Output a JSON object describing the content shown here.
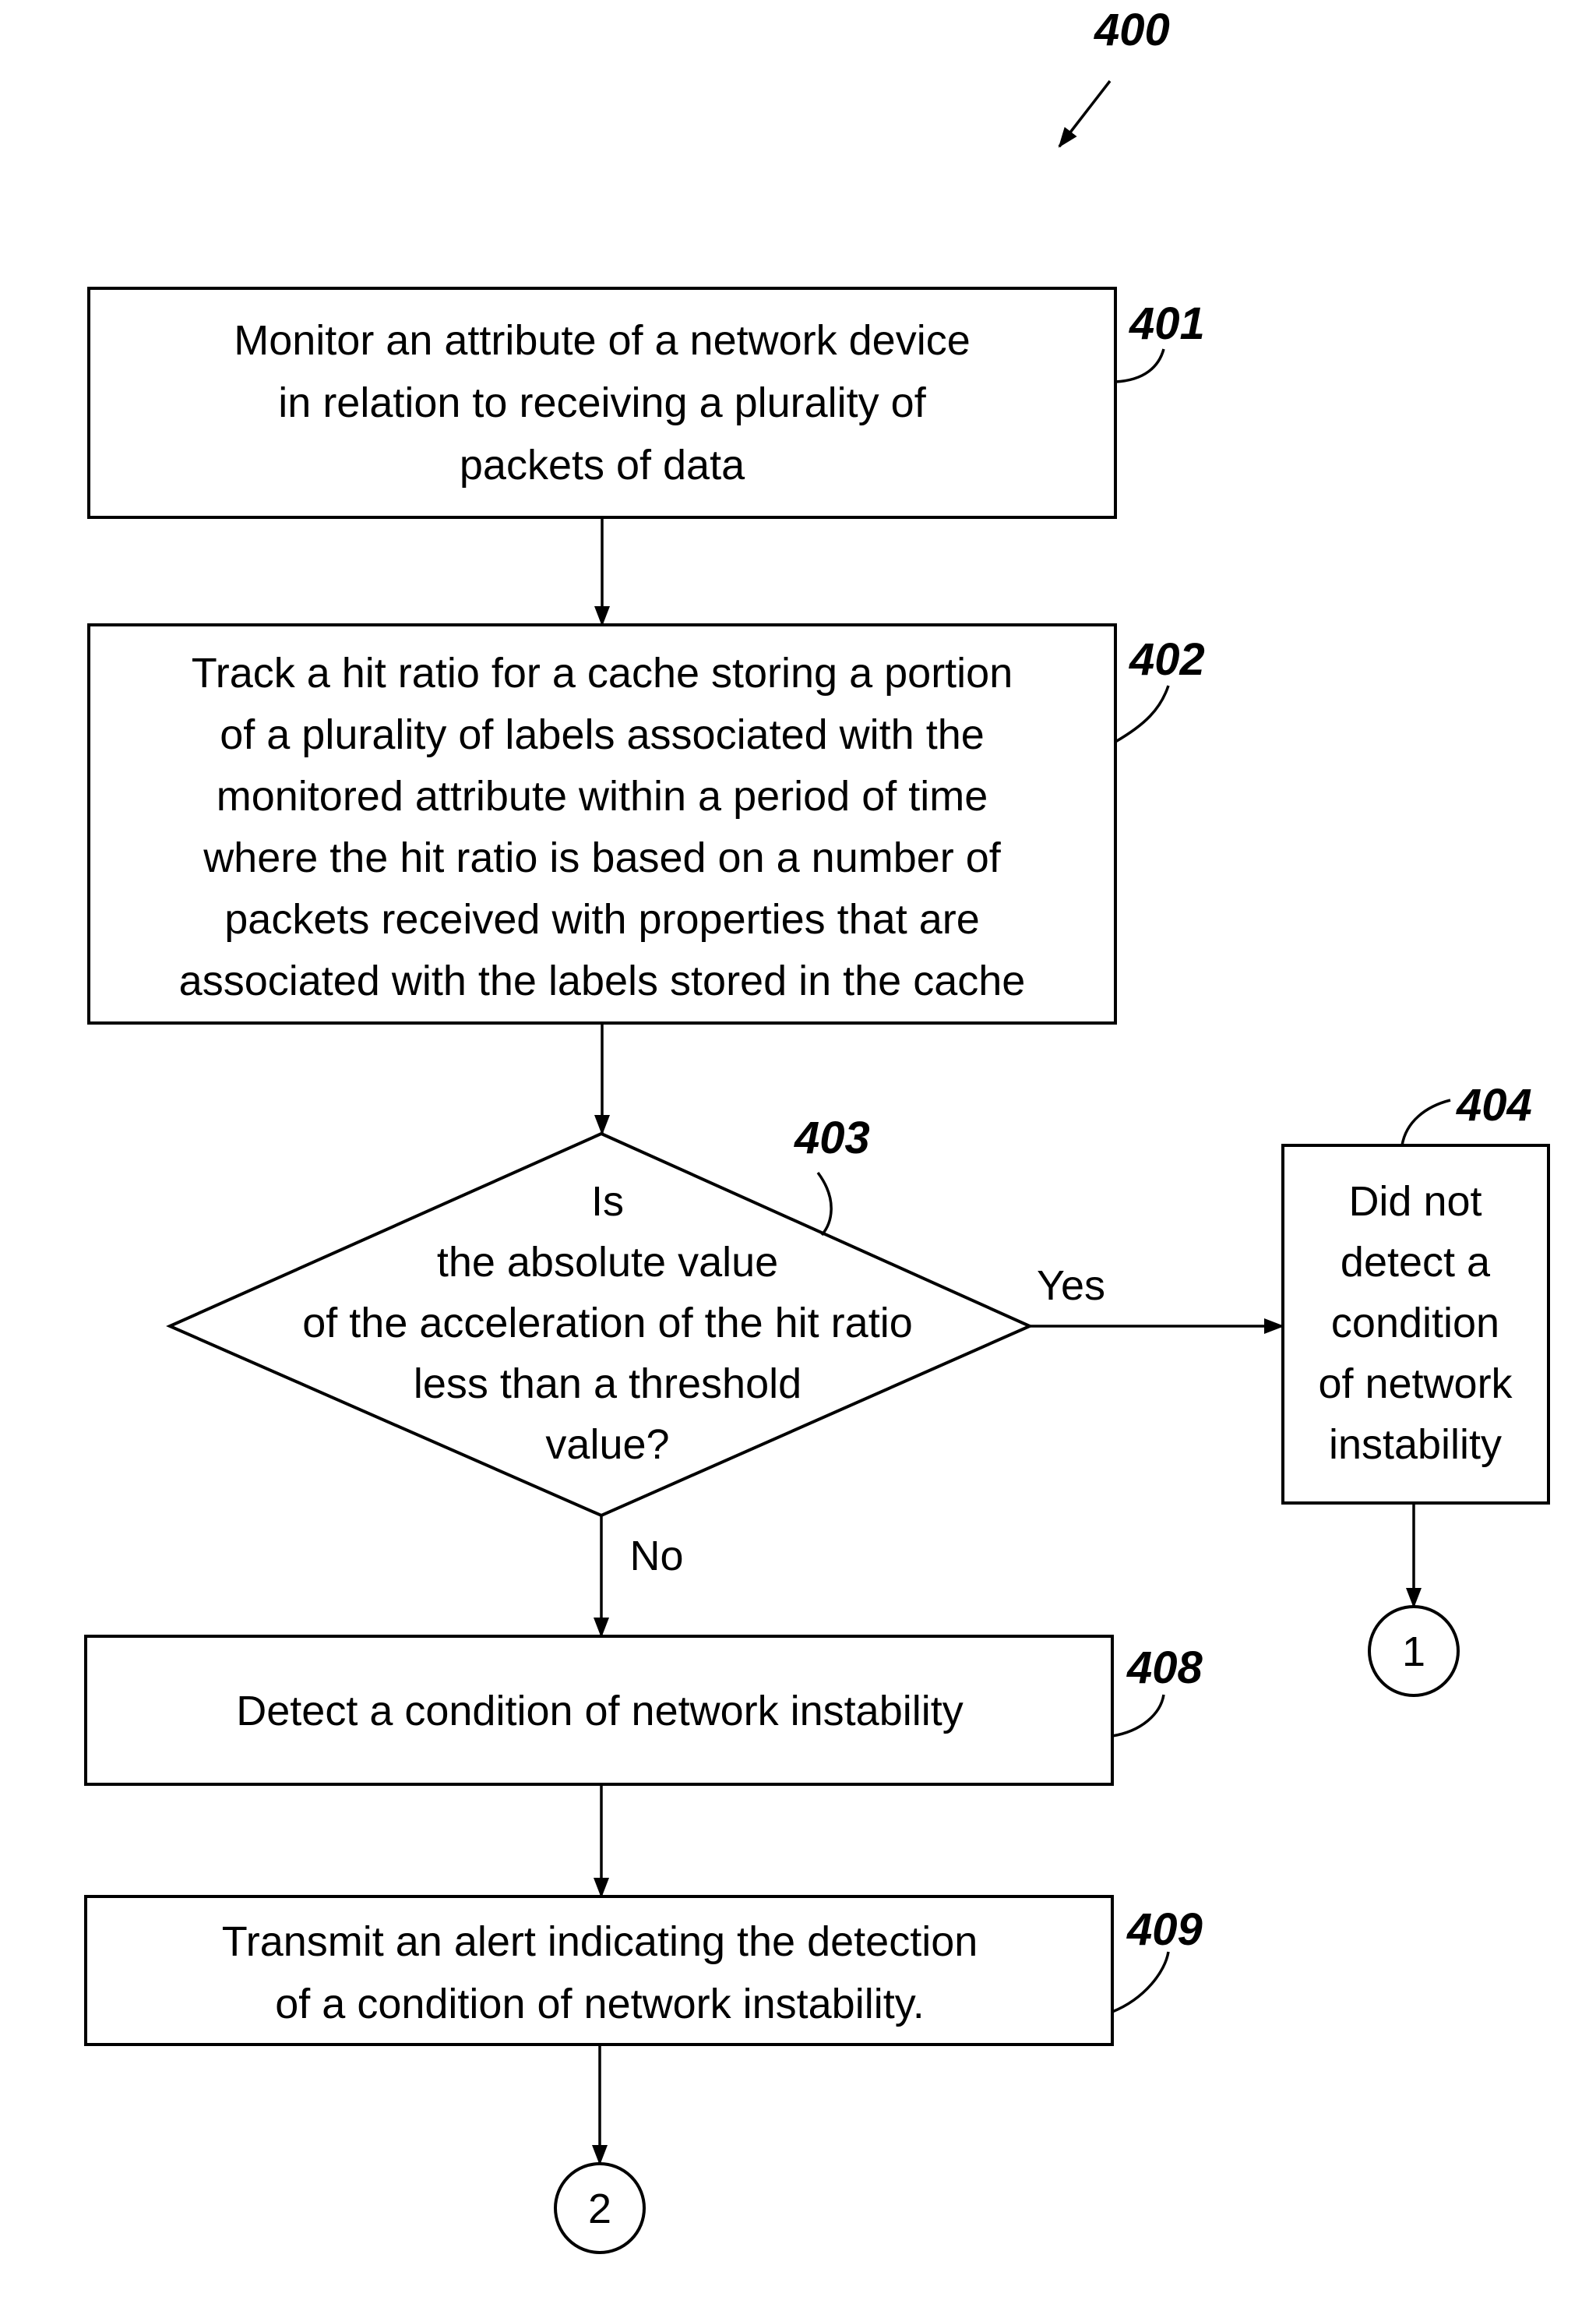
{
  "figure": {
    "ref": "400"
  },
  "steps": {
    "s401": {
      "ref": "401",
      "lines": [
        "Monitor an attribute of a network device",
        "in relation to receiving a plurality of",
        "packets of data"
      ]
    },
    "s402": {
      "ref": "402",
      "lines": [
        "Track a hit ratio for a cache storing a portion",
        "of a plurality of labels associated with the",
        "monitored attribute within a period of time",
        "where the hit ratio is based on a number of",
        "packets received with properties that are",
        "associated with the labels stored in the cache"
      ]
    },
    "s403": {
      "ref": "403",
      "lines": [
        "Is",
        "the absolute value",
        "of the acceleration of the hit ratio",
        "less than a threshold",
        "value?"
      ],
      "yes_label": "Yes",
      "no_label": "No"
    },
    "s404": {
      "ref": "404",
      "lines": [
        "Did not",
        "detect a",
        "condition",
        "of network",
        "instability"
      ]
    },
    "s408": {
      "ref": "408",
      "lines": [
        "Detect a condition of network instability"
      ]
    },
    "s409": {
      "ref": "409",
      "lines": [
        "Transmit an alert indicating the detection",
        "of a condition of network instability."
      ]
    }
  },
  "connectors": {
    "c1": "1",
    "c2": "2"
  }
}
